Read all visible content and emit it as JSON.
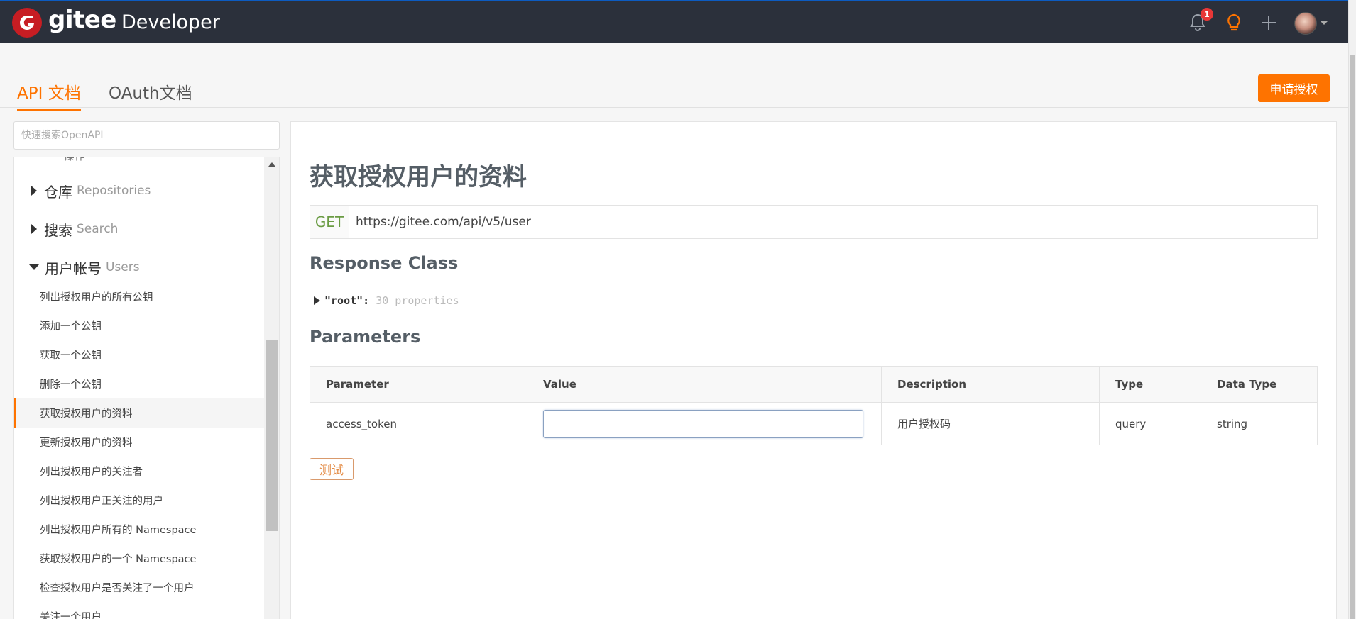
{
  "header": {
    "logo_text": "gitee",
    "logo_sub": "Developer",
    "notification_count": "1",
    "icons": [
      "bell-icon",
      "lightbulb-icon",
      "plus-icon",
      "avatar",
      "chevron-down-icon"
    ]
  },
  "tabs": [
    {
      "label": "API 文档",
      "active": true
    },
    {
      "label": "OAuth文档",
      "active": false
    }
  ],
  "apply_button": "申请授权",
  "search": {
    "placeholder": "快速搜索OpenAPI"
  },
  "sidebar": {
    "cut_off_item": "— 操作 —",
    "groups": [
      {
        "label": "仓库",
        "en": "Repositories",
        "expanded": false
      },
      {
        "label": "搜索",
        "en": "Search",
        "expanded": false
      },
      {
        "label": "用户帐号",
        "en": "Users",
        "expanded": true
      }
    ],
    "items": [
      "列出授权用户的所有公钥",
      "添加一个公钥",
      "获取一个公钥",
      "删除一个公钥",
      "获取授权用户的资料",
      "更新授权用户的资料",
      "列出授权用户的关注者",
      "列出授权用户正关注的用户",
      "列出授权用户所有的 Namespace",
      "获取授权用户的一个 Namespace",
      "检查授权用户是否关注了一个用户",
      "关注一个用户"
    ],
    "active_index": 4
  },
  "main": {
    "title": "获取授权用户的资料",
    "method": "GET",
    "url": "https://gitee.com/api/v5/user",
    "response_heading": "Response Class",
    "model_key": "\"root\":",
    "model_props": "30 properties",
    "params_heading": "Parameters",
    "table": {
      "headers": [
        "Parameter",
        "Value",
        "Description",
        "Type",
        "Data Type"
      ],
      "rows": [
        {
          "parameter": "access_token",
          "value": "",
          "description": "用户授权码",
          "type": "query",
          "data_type": "string"
        }
      ]
    },
    "test_button": "测试"
  },
  "colors": {
    "brand": "#c71d23",
    "accent": "#fe7300",
    "topbar": "#2b303b",
    "get": "#6a9b43"
  }
}
